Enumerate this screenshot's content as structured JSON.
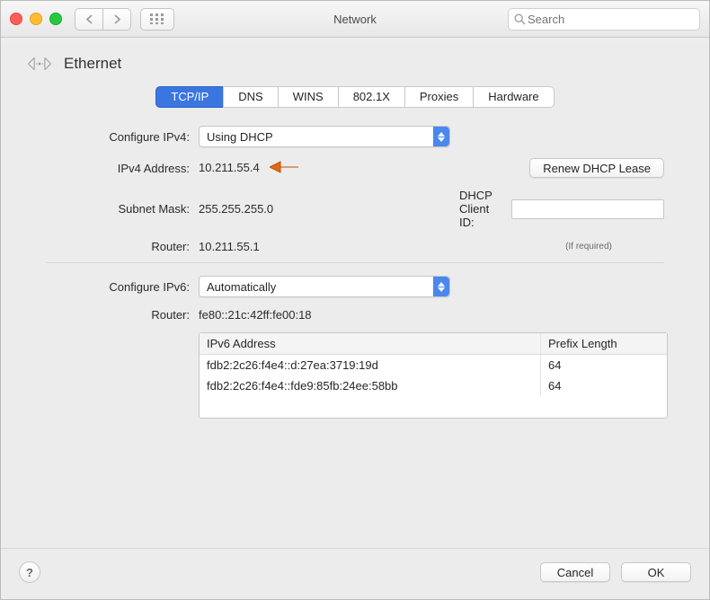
{
  "window": {
    "title": "Network",
    "search_placeholder": "Search"
  },
  "header": {
    "title": "Ethernet"
  },
  "tabs": [
    {
      "label": "TCP/IP",
      "active": true
    },
    {
      "label": "DNS"
    },
    {
      "label": "WINS"
    },
    {
      "label": "802.1X"
    },
    {
      "label": "Proxies"
    },
    {
      "label": "Hardware"
    }
  ],
  "labels": {
    "configure_ipv4": "Configure IPv4:",
    "ipv4_address": "IPv4 Address:",
    "subnet_mask": "Subnet Mask:",
    "router": "Router:",
    "configure_ipv6": "Configure IPv6:",
    "router6": "Router:",
    "dhcp_client_id": "DHCP Client ID:",
    "if_required": "(If required)",
    "renew": "Renew DHCP Lease",
    "ipv6_col_addr": "IPv6 Address",
    "ipv6_col_prefix": "Prefix Length",
    "cancel": "Cancel",
    "ok": "OK"
  },
  "values": {
    "configure_ipv4": "Using DHCP",
    "ipv4_address": "10.211.55.4",
    "subnet_mask": "255.255.255.0",
    "router": "10.211.55.1",
    "configure_ipv6": "Automatically",
    "router6": "fe80::21c:42ff:fe00:18",
    "dhcp_client_id": ""
  },
  "ipv6_rows": [
    {
      "addr": "fdb2:2c26:f4e4::d:27ea:3719:19d",
      "prefix": "64"
    },
    {
      "addr": "fdb2:2c26:f4e4::fde9:85fb:24ee:58bb",
      "prefix": "64"
    }
  ]
}
